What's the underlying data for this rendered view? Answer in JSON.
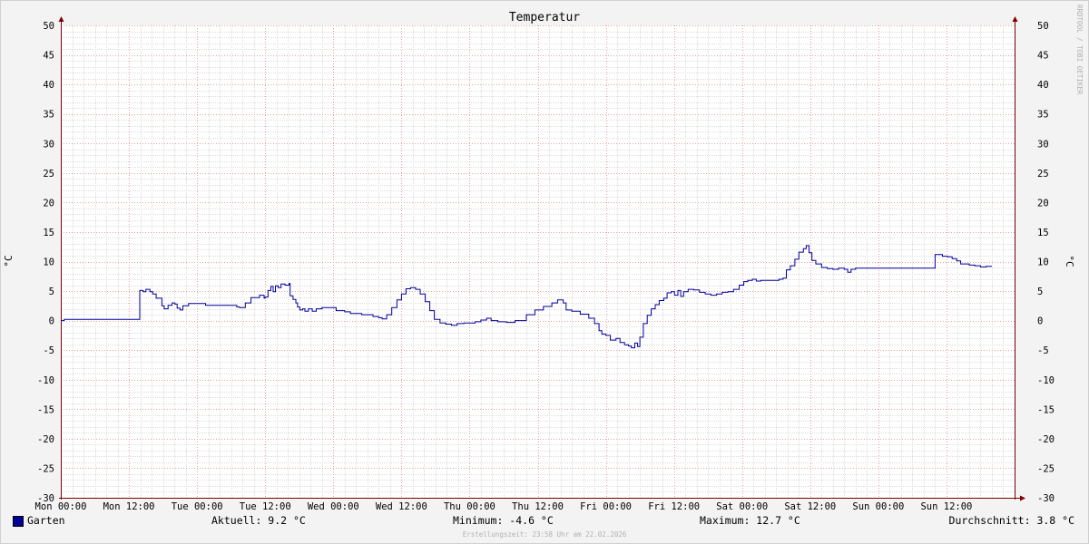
{
  "chart_data": {
    "type": "line",
    "title": "Temperatur",
    "ylabel": "°C",
    "ylabel_right": "°C",
    "ylim": [
      -30,
      50
    ],
    "y_ticks": [
      50,
      45,
      40,
      35,
      30,
      25,
      20,
      15,
      10,
      5,
      0,
      -5,
      -10,
      -15,
      -20,
      -25,
      -30
    ],
    "xlim_hours": [
      0,
      168
    ],
    "x_tick_labels": [
      "Mon 00:00",
      "Mon 12:00",
      "Tue 00:00",
      "Tue 12:00",
      "Wed 00:00",
      "Wed 12:00",
      "Thu 00:00",
      "Thu 12:00",
      "Fri 00:00",
      "Fri 12:00",
      "Sat 00:00",
      "Sat 12:00",
      "Sun 00:00",
      "Sun 12:00"
    ],
    "grid": true,
    "legend_position": "bottom-left",
    "series": [
      {
        "name": "Garten",
        "color": "#000099",
        "points": [
          [
            0.0,
            0.0
          ],
          [
            0.6,
            0.2
          ],
          [
            13.8,
            0.2
          ],
          [
            13.9,
            5.1
          ],
          [
            14.5,
            4.9
          ],
          [
            15.0,
            5.3
          ],
          [
            15.7,
            4.9
          ],
          [
            16.2,
            4.5
          ],
          [
            16.8,
            3.8
          ],
          [
            17.4,
            3.8
          ],
          [
            17.8,
            2.5
          ],
          [
            18.2,
            2.0
          ],
          [
            18.9,
            2.6
          ],
          [
            19.6,
            3.0
          ],
          [
            20.1,
            2.8
          ],
          [
            20.5,
            2.1
          ],
          [
            21.0,
            1.8
          ],
          [
            21.5,
            2.5
          ],
          [
            22.5,
            2.9
          ],
          [
            24.5,
            2.9
          ],
          [
            25.5,
            2.6
          ],
          [
            28.0,
            2.6
          ],
          [
            31.0,
            2.3
          ],
          [
            31.5,
            2.2
          ],
          [
            32.5,
            3.0
          ],
          [
            33.5,
            3.9
          ],
          [
            35.0,
            4.3
          ],
          [
            35.8,
            3.8
          ],
          [
            36.0,
            4.0
          ],
          [
            36.5,
            5.1
          ],
          [
            37.0,
            5.8
          ],
          [
            37.4,
            4.9
          ],
          [
            37.8,
            5.9
          ],
          [
            38.3,
            5.6
          ],
          [
            38.8,
            6.2
          ],
          [
            39.5,
            6.0
          ],
          [
            40.2,
            6.3
          ],
          [
            40.4,
            4.2
          ],
          [
            40.9,
            3.6
          ],
          [
            41.4,
            3.0
          ],
          [
            41.7,
            2.3
          ],
          [
            42.1,
            1.8
          ],
          [
            42.6,
            2.0
          ],
          [
            43.0,
            1.6
          ],
          [
            43.6,
            2.0
          ],
          [
            44.3,
            1.6
          ],
          [
            45.0,
            2.0
          ],
          [
            46.0,
            2.2
          ],
          [
            47.5,
            2.2
          ],
          [
            48.5,
            1.7
          ],
          [
            50.0,
            1.5
          ],
          [
            51.0,
            1.2
          ],
          [
            53.0,
            1.0
          ],
          [
            55.0,
            0.7
          ],
          [
            56.0,
            0.5
          ],
          [
            56.6,
            0.3
          ],
          [
            57.4,
            1.0
          ],
          [
            58.3,
            2.2
          ],
          [
            59.2,
            3.5
          ],
          [
            60.0,
            4.5
          ],
          [
            60.8,
            5.4
          ],
          [
            61.6,
            5.6
          ],
          [
            62.5,
            5.3
          ],
          [
            63.3,
            4.5
          ],
          [
            64.2,
            3.2
          ],
          [
            65.0,
            1.7
          ],
          [
            65.8,
            0.2
          ],
          [
            66.8,
            -0.4
          ],
          [
            67.8,
            -0.6
          ],
          [
            68.8,
            -0.8
          ],
          [
            69.8,
            -0.5
          ],
          [
            71.0,
            -0.4
          ],
          [
            72.0,
            -0.4
          ],
          [
            73.0,
            -0.2
          ],
          [
            74.0,
            0.1
          ],
          [
            75.0,
            0.4
          ],
          [
            75.8,
            0.0
          ],
          [
            77.0,
            -0.2
          ],
          [
            78.5,
            -0.3
          ],
          [
            80.0,
            0.0
          ],
          [
            82.0,
            1.0
          ],
          [
            83.5,
            1.8
          ],
          [
            85.0,
            2.4
          ],
          [
            86.5,
            3.0
          ],
          [
            87.5,
            3.5
          ],
          [
            88.5,
            3.0
          ],
          [
            89.0,
            1.8
          ],
          [
            90.0,
            1.6
          ],
          [
            91.5,
            1.1
          ],
          [
            93.0,
            0.4
          ],
          [
            94.0,
            -0.5
          ],
          [
            94.8,
            -1.7
          ],
          [
            95.3,
            -2.3
          ],
          [
            96.0,
            -2.5
          ],
          [
            96.8,
            -3.3
          ],
          [
            97.8,
            -3.0
          ],
          [
            98.5,
            -3.7
          ],
          [
            99.3,
            -4.1
          ],
          [
            100.0,
            -4.3
          ],
          [
            100.5,
            -4.6
          ],
          [
            101.1,
            -3.8
          ],
          [
            101.6,
            -4.4
          ],
          [
            102.0,
            -2.8
          ],
          [
            102.6,
            -0.5
          ],
          [
            103.3,
            0.9
          ],
          [
            104.0,
            2.0
          ],
          [
            104.7,
            2.7
          ],
          [
            105.4,
            3.4
          ],
          [
            106.2,
            3.8
          ],
          [
            106.8,
            4.7
          ],
          [
            107.5,
            4.9
          ],
          [
            108.1,
            4.3
          ],
          [
            108.7,
            5.1
          ],
          [
            109.2,
            4.1
          ],
          [
            109.7,
            4.9
          ],
          [
            110.5,
            5.3
          ],
          [
            111.5,
            5.2
          ],
          [
            112.5,
            4.8
          ],
          [
            113.5,
            4.5
          ],
          [
            114.5,
            4.3
          ],
          [
            115.5,
            4.5
          ],
          [
            116.5,
            4.8
          ],
          [
            117.5,
            4.9
          ],
          [
            118.5,
            5.3
          ],
          [
            119.5,
            6.0
          ],
          [
            120.3,
            6.6
          ],
          [
            121.0,
            6.8
          ],
          [
            121.8,
            7.0
          ],
          [
            122.5,
            6.7
          ],
          [
            123.3,
            6.8
          ],
          [
            124.5,
            6.8
          ],
          [
            125.5,
            6.8
          ],
          [
            126.5,
            7.0
          ],
          [
            127.2,
            7.2
          ],
          [
            127.8,
            8.6
          ],
          [
            128.5,
            9.3
          ],
          [
            129.3,
            10.4
          ],
          [
            130.0,
            11.6
          ],
          [
            130.8,
            12.2
          ],
          [
            131.3,
            12.7
          ],
          [
            131.8,
            11.5
          ],
          [
            132.3,
            10.2
          ],
          [
            133.0,
            9.6
          ],
          [
            134.0,
            9.0
          ],
          [
            135.0,
            8.8
          ],
          [
            136.0,
            8.7
          ],
          [
            137.0,
            8.9
          ],
          [
            138.0,
            8.7
          ],
          [
            138.6,
            8.2
          ],
          [
            139.2,
            8.7
          ],
          [
            140.0,
            8.9
          ],
          [
            145.0,
            8.9
          ],
          [
            150.0,
            8.9
          ],
          [
            153.5,
            8.9
          ],
          [
            154.0,
            11.2
          ],
          [
            154.6,
            11.2
          ],
          [
            155.3,
            10.9
          ],
          [
            156.2,
            10.8
          ],
          [
            157.0,
            10.5
          ],
          [
            157.8,
            10.1
          ],
          [
            158.5,
            9.6
          ],
          [
            159.3,
            9.6
          ],
          [
            160.0,
            9.4
          ],
          [
            161.0,
            9.3
          ],
          [
            162.0,
            9.1
          ],
          [
            163.0,
            9.2
          ],
          [
            164.0,
            9.2
          ]
        ]
      }
    ]
  },
  "legend": {
    "series_name": "Garten",
    "color": "#000099"
  },
  "stats": {
    "aktuell": "Aktuell: 9.2 °C",
    "minimum": "Minimum: -4.6 °C",
    "maximum": "Maximum: 12.7 °C",
    "durchschnitt": "Durchschnitt: 3.8 °C"
  },
  "footer": {
    "creation_time": "Erstellungszeit: 23:58 Uhr am 22.02.2026"
  },
  "watermark": "RRDTOOL / TOBI OETIKER"
}
